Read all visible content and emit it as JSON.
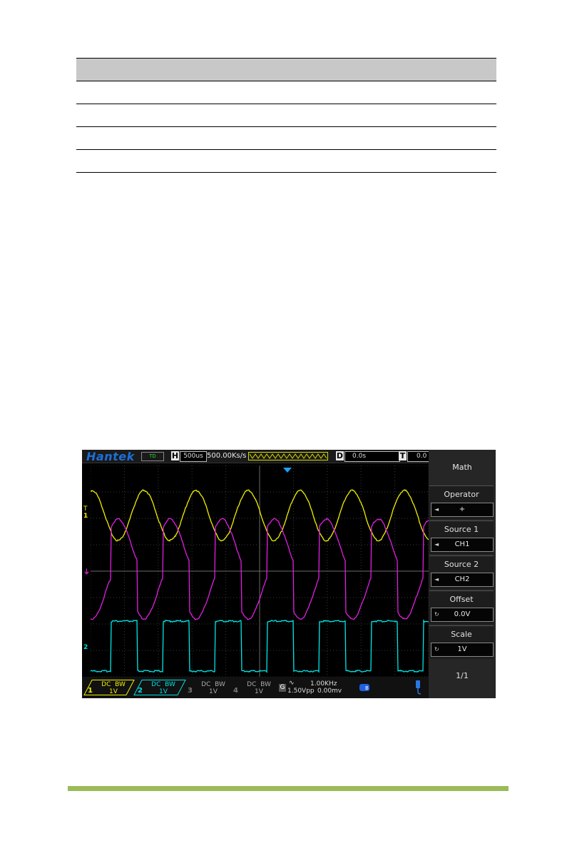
{
  "table": {
    "rows": [
      "",
      "",
      "",
      ""
    ]
  },
  "scope": {
    "brand": "Hantek",
    "mode_badge": "TD",
    "horizontal": {
      "tag": "H",
      "value": "500us"
    },
    "sample_rate": "500.00Ks/s",
    "delay": {
      "tag": "D",
      "value": "0.0s"
    },
    "trigger": {
      "tag": "T",
      "value": "0.0"
    },
    "channel_markers": {
      "ch1": "1",
      "ch2": "2",
      "trigger_mark": "T"
    },
    "menu": {
      "title": "Math",
      "items": [
        {
          "label": "Operator",
          "value": "+"
        },
        {
          "label": "Source 1",
          "value": "CH1"
        },
        {
          "label": "Source 2",
          "value": "CH2"
        },
        {
          "label": "Offset",
          "value": "0.0V"
        },
        {
          "label": "Scale",
          "value": "1V"
        }
      ],
      "page": "1/1"
    },
    "channels": [
      {
        "num": "1",
        "coupling": "DC",
        "bw": "BW",
        "scale": "1V",
        "color": "#f0f000"
      },
      {
        "num": "2",
        "coupling": "DC",
        "bw": "BW",
        "scale": "1V",
        "color": "#00e0e0"
      },
      {
        "num": "3",
        "coupling": "DC",
        "bw": "BW",
        "scale": "1V",
        "color": "#888888"
      },
      {
        "num": "4",
        "coupling": "DC",
        "bw": "BW",
        "scale": "1V",
        "color": "#888888"
      }
    ],
    "generator": {
      "tag": "G",
      "frequency": "1.00KHz",
      "amplitude": "1.50Vpp",
      "offset": "0.00mv"
    },
    "trace_colors": {
      "ch1": "#f0f000",
      "ch2": "#00e6e6",
      "math": "#e020e0"
    }
  }
}
